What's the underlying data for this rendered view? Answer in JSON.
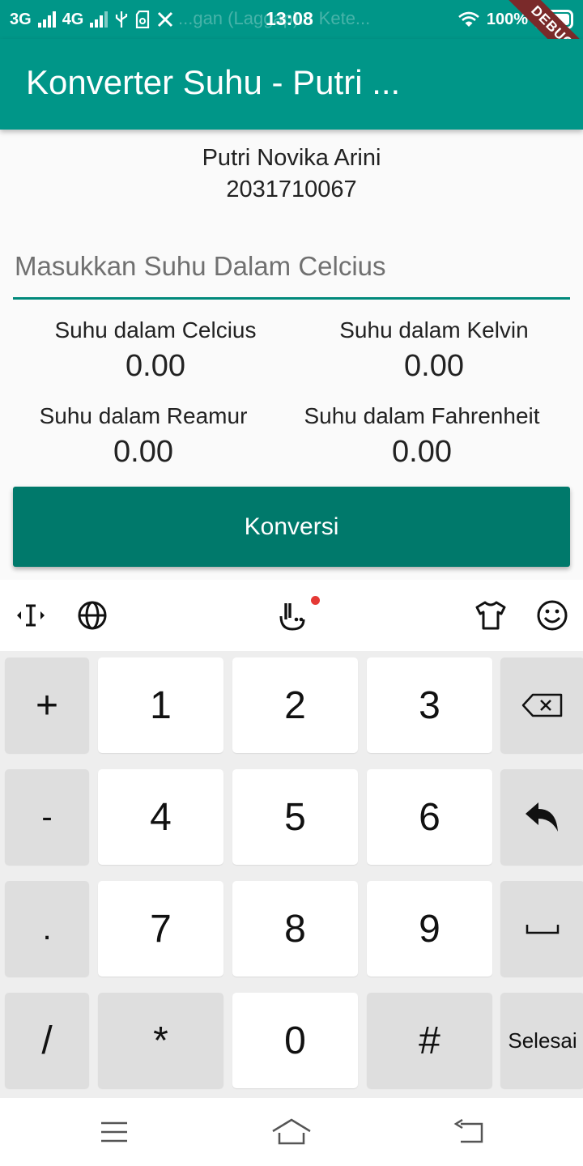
{
  "status_bar": {
    "network_1": "3G",
    "network_2": "4G",
    "background_text": "...gan (Laggap)... Kete...",
    "time": "13:08",
    "battery_percent": "100%",
    "battery_level": 1.0,
    "debug_label": "DEBUG"
  },
  "app_bar": {
    "title": "Konverter Suhu - Putri ...",
    "color": "#009688"
  },
  "identity": {
    "name": "Putri Novika Arini",
    "nim": "2031710067"
  },
  "input": {
    "placeholder": "Masukkan Suhu Dalam Celcius",
    "value": ""
  },
  "results": {
    "celcius": {
      "label": "Suhu dalam Celcius",
      "value": "0.00"
    },
    "kelvin": {
      "label": "Suhu dalam Kelvin",
      "value": "0.00"
    },
    "reamur": {
      "label": "Suhu dalam Reamur",
      "value": "0.00"
    },
    "fahrenheit": {
      "label": "Suhu dalam Fahrenheit",
      "value": "0.00"
    }
  },
  "button": {
    "label": "Konversi",
    "color": "#00796b"
  },
  "keyboard": {
    "toolbar_icons": [
      "text-cursor-icon",
      "globe-icon",
      "gesture-hand-icon",
      "theme-shirt-icon",
      "emoji-icon"
    ],
    "keys": {
      "plus": "+",
      "one": "1",
      "two": "2",
      "three": "3",
      "minus": "-",
      "four": "4",
      "five": "5",
      "six": "6",
      "dot": ".",
      "seven": "7",
      "eight": "8",
      "nine": "9",
      "slash": "/",
      "star": "*",
      "zero": "0",
      "hash": "#",
      "done": "Selesai"
    }
  },
  "nav_bar": {
    "icons": [
      "menu-icon",
      "home-icon",
      "back-icon"
    ]
  }
}
